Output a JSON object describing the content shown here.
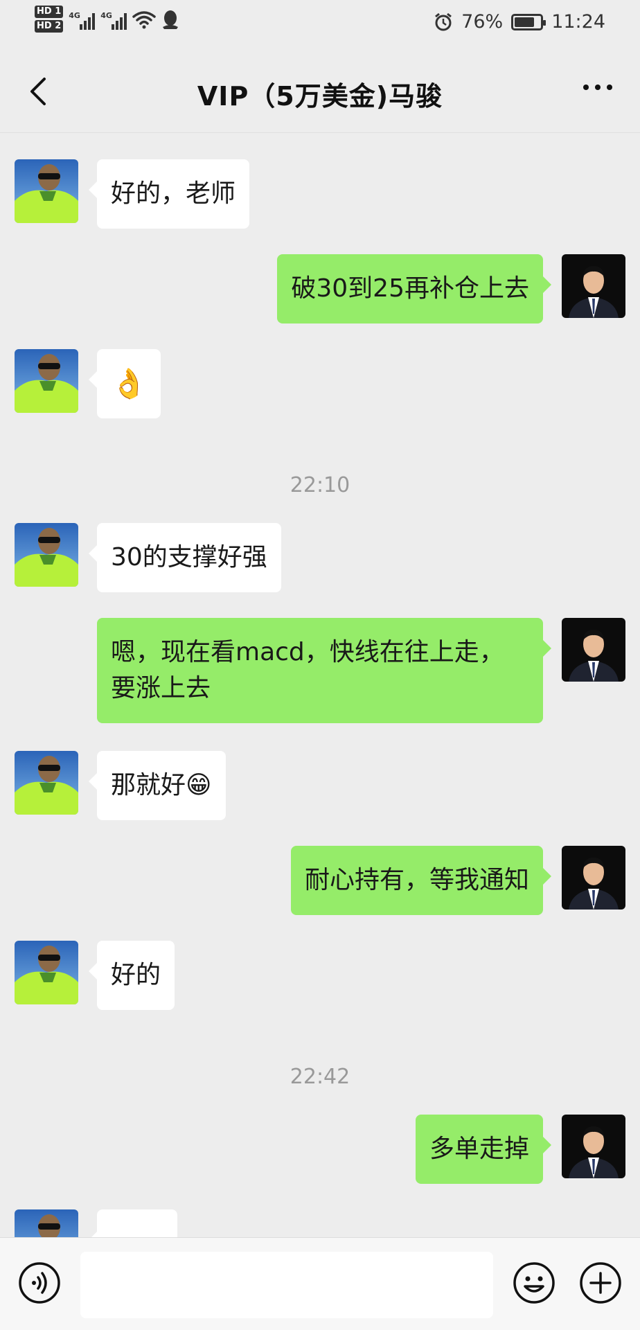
{
  "status_bar": {
    "hd1": "HD 1",
    "hd2": "HD 2",
    "net1": "4G",
    "net2": "4G",
    "battery_percent": "76%",
    "battery_level": 0.76,
    "time": "11:24"
  },
  "header": {
    "title": "VIP（5万美金)马骏"
  },
  "messages": [
    {
      "side": "left",
      "text": "好的，老师"
    },
    {
      "side": "right",
      "text": "破30到25再补仓上去"
    },
    {
      "side": "left",
      "text": "👌"
    },
    {
      "timestamp": "22:10"
    },
    {
      "side": "left",
      "text": "30的支撑好强"
    },
    {
      "side": "right",
      "line1": "嗯，现在看macd，快线在往上走，",
      "line2": "要涨上去"
    },
    {
      "side": "left",
      "text": "那就好😁"
    },
    {
      "side": "right",
      "text": "耐心持有，等我通知"
    },
    {
      "side": "left",
      "text": "好的"
    },
    {
      "timestamp": "22:42"
    },
    {
      "side": "right",
      "text": "多单走掉"
    },
    {
      "side": "left",
      "text": ""
    }
  ],
  "input_bar": {
    "placeholder": ""
  },
  "colors": {
    "background": "#ededed",
    "bubble_sent": "#95ec69",
    "bubble_received": "#ffffff"
  },
  "icons": [
    "back-arrow-icon",
    "more-dots-icon",
    "voice-icon",
    "emoji-icon",
    "plus-icon",
    "alarm-icon",
    "wifi-icon",
    "qq-icon"
  ]
}
